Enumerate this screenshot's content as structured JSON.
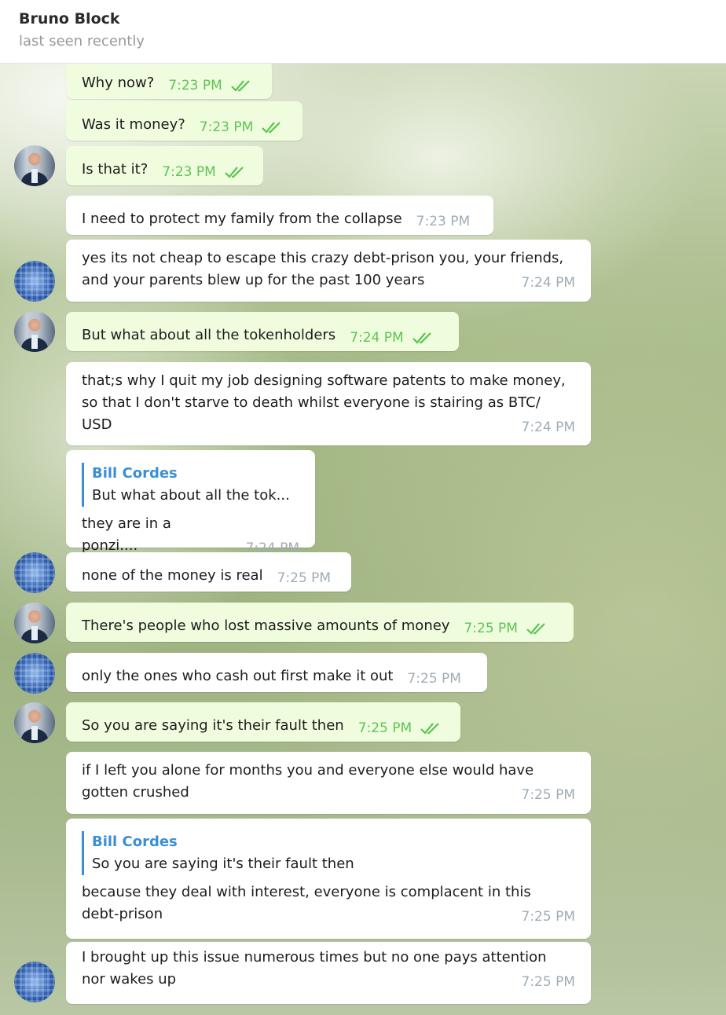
{
  "header": {
    "contact_name": "Bruno Block",
    "status": "last seen recently"
  },
  "icons": {
    "read_receipt": "double-check-icon",
    "avatar_bill": "avatar-bill-cordes",
    "avatar_bruno": "avatar-bruno-block"
  },
  "colors": {
    "outgoing_bubble": "#effdde",
    "incoming_bubble": "#ffffff",
    "outgoing_time": "#5dc452",
    "quote_accent": "#3a8fd6"
  },
  "messages": [
    {
      "text": "Why now?",
      "time": "7:23 PM"
    },
    {
      "text": "Was it money?",
      "time": "7:23 PM"
    },
    {
      "text": "Is that it?",
      "time": "7:23 PM"
    },
    {
      "text": "I need to protect my family from the collapse",
      "time": "7:23 PM"
    },
    {
      "text": "yes its not cheap to escape this crazy debt-prison you, your friends,\nand your parents blew up for the past 100 years",
      "time": "7:24 PM"
    },
    {
      "text": "But what about all the tokenholders",
      "time": "7:24 PM"
    },
    {
      "text": "that;s why I quit my job designing software patents to make money,\nso that I don't starve to death whilst everyone is stairing as BTC/\nUSD",
      "time": "7:24 PM"
    },
    {
      "quote_name": "Bill Cordes",
      "quote_text": "But what about all the tok...",
      "text": "they are in a ponzi....",
      "time": "7:24 PM"
    },
    {
      "text": "none of the money is real",
      "time": "7:25 PM"
    },
    {
      "text": "There's people who lost massive amounts of money",
      "time": "7:25 PM"
    },
    {
      "text": "only the ones who cash out first make it out",
      "time": "7:25 PM"
    },
    {
      "text": "So you are saying it's their fault then",
      "time": "7:25 PM"
    },
    {
      "text": "if I left you alone for months you and everyone else would have\ngotten crushed",
      "time": "7:25 PM"
    },
    {
      "quote_name": "Bill Cordes",
      "quote_text": "So you are saying it's their fault then",
      "text": "because they deal with interest, everyone is complacent in this\ndebt-prison",
      "time": "7:25 PM"
    },
    {
      "text": "I brought up this issue numerous times but no one pays attention\nnor wakes up",
      "time": "7:25 PM"
    }
  ]
}
